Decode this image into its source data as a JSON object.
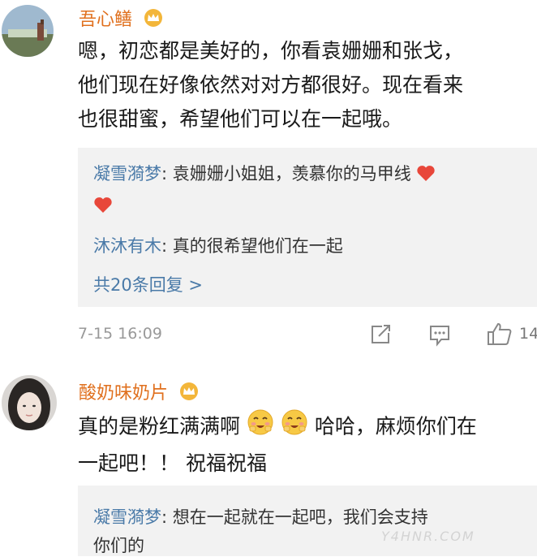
{
  "comments": [
    {
      "username": "吾心鳝",
      "content_lines": [
        "嗯，初恋都是美好的，你看袁姗姗和张戈，",
        "他们现在好像依然对对方都很好。现在看来",
        "也很甜蜜，希望他们可以在一起哦。"
      ],
      "replies": [
        {
          "user": "凝雪漪梦",
          "text": ": 袁姗姗小姐姐，羡慕你的马甲线"
        },
        {
          "user": "沐沐有木",
          "text": ": 真的很希望他们在一起"
        }
      ],
      "more_replies": "共20条回复 >",
      "timestamp": "7-15 16:09",
      "like_count": "14"
    },
    {
      "username": "酸奶味奶片",
      "content_line1_a": "真的是粉红满满啊",
      "content_line1_b": "哈哈，麻烦你们在",
      "content_line2": "一起吧！！ 祝福祝福",
      "replies": [
        {
          "user": "凝雪漪梦",
          "text": ": 想在一起就在一起吧，我们会支持",
          "text2": "你们的"
        }
      ]
    }
  ],
  "icons": {
    "crown": "vip-crown-icon",
    "heart": "red-heart-emoji",
    "share": "share-icon",
    "comment": "comment-icon",
    "like": "like-icon",
    "blush": "blush-emoji"
  },
  "colors": {
    "username": "#e0701e",
    "reply_user": "#4a7aa8",
    "heart": "#e8473a"
  },
  "watermark": "Y4HNR.COM"
}
